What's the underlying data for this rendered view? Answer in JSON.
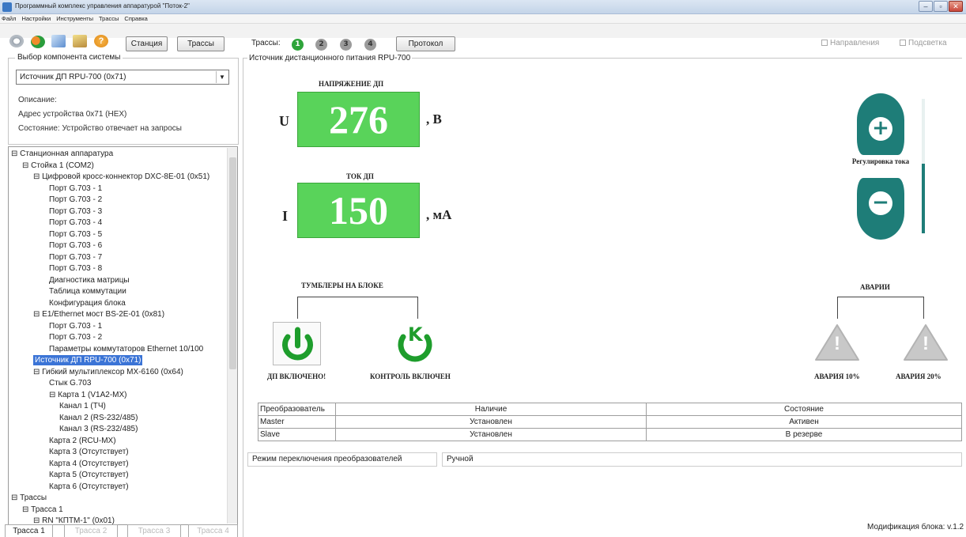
{
  "window": {
    "title": "Программный комплекс управления аппаратурой \"Поток-2\"",
    "buttons": {
      "minimize": "–",
      "maximize": "▫",
      "close": "✕"
    }
  },
  "menu": [
    "Файл",
    "Настройки",
    "Инструменты",
    "Трассы",
    "Справка"
  ],
  "toolbar": {
    "icons": [
      "gear-icon",
      "network-icon",
      "chart-icon",
      "edit-icon",
      "help-icon"
    ],
    "station_label": "Станция",
    "routes_label": "Трассы",
    "routes_caption": "Трассы:",
    "route_numbers": [
      "1",
      "2",
      "3",
      "4"
    ],
    "protocol_label": "Протокол",
    "directions_label": "Направления",
    "highlight_label": "Подсветка"
  },
  "component_select": {
    "legend": "Выбор компонента системы",
    "selected": "Источник ДП RPU-700 (0x71)",
    "description_label": "Описание:",
    "address_line": "Адрес устройства   0x71 (HEX)",
    "state_line": "Состояние:  Устройство отвечает на запросы"
  },
  "tree": [
    {
      "text": "⊟ Станционная аппаратура",
      "level": 0
    },
    {
      "text": "⊟ Стойка 1 (COM2)",
      "level": 1
    },
    {
      "text": "⊟ Цифровой кросс-коннектор DXC-8E-01 (0x51)",
      "level": 2
    },
    {
      "text": "Порт G.703 - 1",
      "level": 3
    },
    {
      "text": "Порт G.703 - 2",
      "level": 3
    },
    {
      "text": "Порт G.703 - 3",
      "level": 3
    },
    {
      "text": "Порт G.703 - 4",
      "level": 3
    },
    {
      "text": "Порт G.703 - 5",
      "level": 3
    },
    {
      "text": "Порт G.703 - 6",
      "level": 3
    },
    {
      "text": "Порт G.703 - 7",
      "level": 3
    },
    {
      "text": "Порт G.703 - 8",
      "level": 3
    },
    {
      "text": "Диагностика матрицы",
      "level": 3
    },
    {
      "text": "Таблица коммутации",
      "level": 3
    },
    {
      "text": "Конфигурация блока",
      "level": 3
    },
    {
      "text": "⊟ E1/Ethernet мост BS-2E-01 (0x81)",
      "level": 2
    },
    {
      "text": "Порт G.703 - 1",
      "level": 3
    },
    {
      "text": "Порт G.703 - 2",
      "level": 3
    },
    {
      "text": "Параметры коммутаторов Ethernet 10/100",
      "level": 3
    },
    {
      "text": "Источник ДП RPU-700 (0x71)",
      "level": 2,
      "selected": true
    },
    {
      "text": "⊟ Гибкий мультиплексор MX-6160 (0x64)",
      "level": 2
    },
    {
      "text": "Стык G.703",
      "level": 3
    },
    {
      "text": "⊟ Карта 1 (V1A2-MX)",
      "level": 3
    },
    {
      "text": "Канал 1 (ТЧ)",
      "level": 4
    },
    {
      "text": "Канал 2 (RS-232/485)",
      "level": 4
    },
    {
      "text": "Канал 3 (RS-232/485)",
      "level": 4
    },
    {
      "text": "Карта 2 (RCU-MX)",
      "level": 3
    },
    {
      "text": "Карта 3 (Отсутствует)",
      "level": 3
    },
    {
      "text": "Карта 4 (Отсутствует)",
      "level": 3
    },
    {
      "text": "Карта 5 (Отсутствует)",
      "level": 3
    },
    {
      "text": "Карта 6 (Отсутствует)",
      "level": 3
    },
    {
      "text": "⊟ Трассы",
      "level": 0
    },
    {
      "text": "⊟ Трасса 1",
      "level": 1
    },
    {
      "text": "⊟ RN \"КПТМ-1\" (0x01)",
      "level": 2
    }
  ],
  "bottom_tabs": [
    "Трасса 1",
    "Трасса 2",
    "Трасса 3",
    "Трасса 4"
  ],
  "panel": {
    "legend": "Источник дистанционного питания RPU-700",
    "voltage_title": "НАПРЯЖЕНИЕ ДП",
    "voltage_symbol": "U",
    "voltage_value": "276",
    "voltage_unit": ", В",
    "current_title": "ТОК ДП",
    "current_symbol": "I",
    "current_value": "150",
    "current_unit": ", мА",
    "adjust_label": "Регулировка тока",
    "plus_glyph": "+",
    "minus_glyph": "−",
    "current_level_fraction": 0.52,
    "switches_title": "ТУМБЛЕРЫ НА БЛОКЕ",
    "power_caption": "ДП ВКЛЮЧЕНО!",
    "control_caption": "КОНТРОЛЬ ВКЛЮЧЕН",
    "control_letter": "K",
    "alarms_title": "АВАРИИ",
    "alarm1_caption": "АВАРИЯ 10%",
    "alarm2_caption": "АВАРИЯ 20%",
    "alarm_glyph": "!"
  },
  "converters": {
    "headers": [
      "Преобразователь",
      "Наличие",
      "Состояние"
    ],
    "rows": [
      [
        "Master",
        "Установлен",
        "Активен"
      ],
      [
        "Slave",
        "Установлен",
        "В резерве"
      ]
    ]
  },
  "mode": {
    "label": "Режим переключения преобразователей",
    "value": "Ручной"
  },
  "footer": "Модификация блока: v.1.2",
  "colors": {
    "meter_green": "#59d35a",
    "teal": "#1e7d78",
    "selection_blue": "#3b74d6",
    "alarm_grey": "#c8c8c8"
  }
}
